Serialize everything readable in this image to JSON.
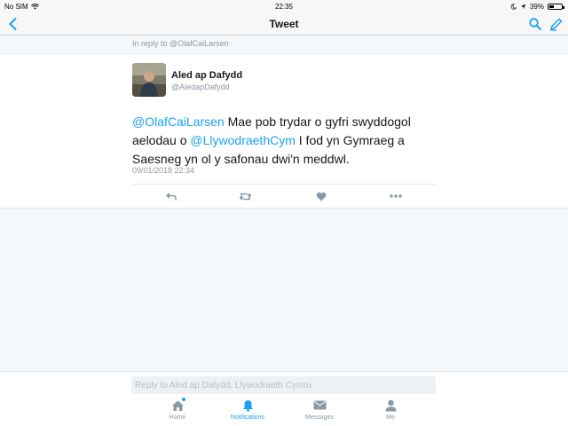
{
  "status_bar": {
    "carrier": "No SIM",
    "time": "22:35",
    "battery": "39%",
    "battery_level": 0.39
  },
  "nav": {
    "title": "Tweet",
    "accent": "#1da1f2"
  },
  "tweet": {
    "reply_context": "In reply to @OlafCaiLarsen",
    "author_name": "Aled ap Dafydd",
    "author_handle": "@AledapDafydd",
    "text_parts": {
      "mention1": "@OlafCaiLarsen",
      "t1": " Mae pob trydar o gyfri swyddogol aelodau o ",
      "mention2": "@LlywodraethCym",
      "t2": " I fod yn Gymraeg a Saesneg yn ol y safonau dwi'n meddwl."
    },
    "timestamp": "09/01/2018 22:34",
    "actions": [
      "reply-icon",
      "retweet-icon",
      "like-icon",
      "more-icon"
    ]
  },
  "reply": {
    "placeholder": "Reply to Aled ap Dafydd, Llywodraeth Cymru"
  },
  "tabs": [
    {
      "label": "Home",
      "icon": "home-icon",
      "active": false
    },
    {
      "label": "Notifications",
      "icon": "bell-icon",
      "active": true
    },
    {
      "label": "Messages",
      "icon": "envelope-icon",
      "active": false
    },
    {
      "label": "Me",
      "icon": "person-icon",
      "active": false
    }
  ],
  "colors": {
    "accent": "#1da1f2",
    "muted": "#8899a6",
    "text": "#14171a"
  }
}
